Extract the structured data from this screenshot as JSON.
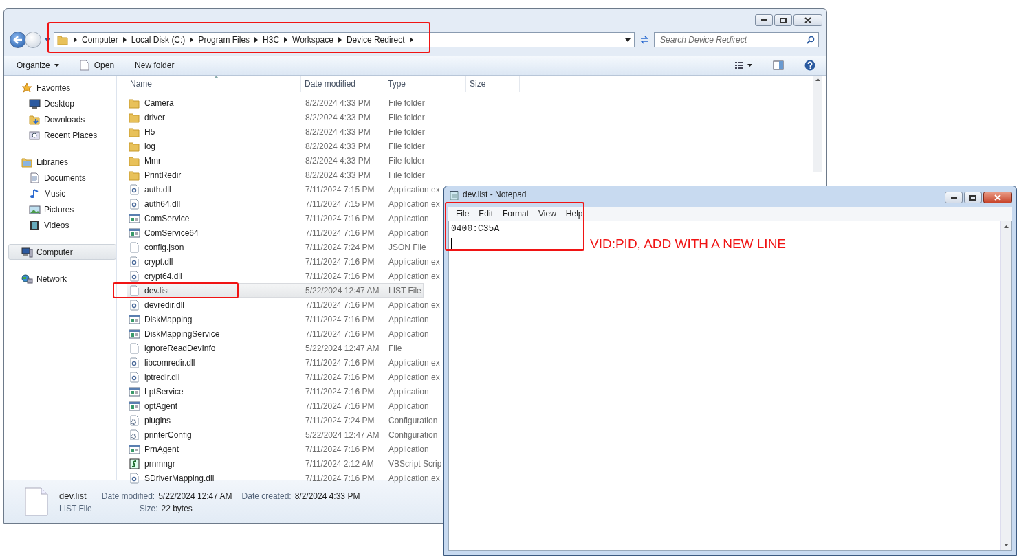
{
  "explorer": {
    "address": {
      "crumbs": [
        "Computer",
        "Local Disk (C:)",
        "Program Files",
        "H3C",
        "Workspace",
        "Device Redirect"
      ]
    },
    "search": {
      "placeholder": "Search Device Redirect"
    },
    "toolbar": {
      "organize": "Organize",
      "open": "Open",
      "new_folder": "New folder"
    },
    "sidebar": {
      "groups": [
        {
          "label": "Favorites",
          "selected": false,
          "children": [
            {
              "label": "Desktop",
              "selected": false
            },
            {
              "label": "Downloads",
              "selected": false
            },
            {
              "label": "Recent Places",
              "selected": false
            }
          ]
        },
        {
          "label": "Libraries",
          "selected": false,
          "children": [
            {
              "label": "Documents",
              "selected": false
            },
            {
              "label": "Music",
              "selected": false
            },
            {
              "label": "Pictures",
              "selected": false
            },
            {
              "label": "Videos",
              "selected": false
            }
          ]
        },
        {
          "label": "Computer",
          "selected": true
        },
        {
          "label": "Network",
          "selected": false
        }
      ]
    },
    "table": {
      "columns": [
        "Name",
        "Date modified",
        "Type",
        "Size"
      ],
      "rows": [
        {
          "kind": "folder",
          "name": "Camera",
          "date": "8/2/2024 4:33 PM",
          "type": "File folder",
          "selected": false
        },
        {
          "kind": "folder",
          "name": "driver",
          "date": "8/2/2024 4:33 PM",
          "type": "File folder",
          "selected": false
        },
        {
          "kind": "folder",
          "name": "H5",
          "date": "8/2/2024 4:33 PM",
          "type": "File folder",
          "selected": false
        },
        {
          "kind": "folder",
          "name": "log",
          "date": "8/2/2024 4:33 PM",
          "type": "File folder",
          "selected": false
        },
        {
          "kind": "folder",
          "name": "Mmr",
          "date": "8/2/2024 4:33 PM",
          "type": "File folder",
          "selected": false
        },
        {
          "kind": "folder",
          "name": "PrintRedir",
          "date": "8/2/2024 4:33 PM",
          "type": "File folder",
          "selected": false
        },
        {
          "kind": "dll",
          "name": "auth.dll",
          "date": "7/11/2024 7:15 PM",
          "type": "Application ex",
          "selected": false
        },
        {
          "kind": "dll",
          "name": "auth64.dll",
          "date": "7/11/2024 7:15 PM",
          "type": "Application ex",
          "selected": false
        },
        {
          "kind": "app",
          "name": "ComService",
          "date": "7/11/2024 7:16 PM",
          "type": "Application",
          "selected": false
        },
        {
          "kind": "app",
          "name": "ComService64",
          "date": "7/11/2024 7:16 PM",
          "type": "Application",
          "selected": false
        },
        {
          "kind": "file",
          "name": "config.json",
          "date": "7/11/2024 7:24 PM",
          "type": "JSON File",
          "selected": false
        },
        {
          "kind": "dll",
          "name": "crypt.dll",
          "date": "7/11/2024 7:16 PM",
          "type": "Application ex",
          "selected": false
        },
        {
          "kind": "dll",
          "name": "crypt64.dll",
          "date": "7/11/2024 7:16 PM",
          "type": "Application ex",
          "selected": false
        },
        {
          "kind": "file",
          "name": "dev.list",
          "date": "5/22/2024 12:47 AM",
          "type": "LIST File",
          "selected": true
        },
        {
          "kind": "dll",
          "name": "devredir.dll",
          "date": "7/11/2024 7:16 PM",
          "type": "Application ex",
          "selected": false
        },
        {
          "kind": "app",
          "name": "DiskMapping",
          "date": "7/11/2024 7:16 PM",
          "type": "Application",
          "selected": false
        },
        {
          "kind": "app",
          "name": "DiskMappingService",
          "date": "7/11/2024 7:16 PM",
          "type": "Application",
          "selected": false
        },
        {
          "kind": "file",
          "name": "ignoreReadDevInfo",
          "date": "5/22/2024 12:47 AM",
          "type": "File",
          "selected": false
        },
        {
          "kind": "dll",
          "name": "libcomredir.dll",
          "date": "7/11/2024 7:16 PM",
          "type": "Application ex",
          "selected": false
        },
        {
          "kind": "dll",
          "name": "lptredir.dll",
          "date": "7/11/2024 7:16 PM",
          "type": "Application ex",
          "selected": false
        },
        {
          "kind": "app",
          "name": "LptService",
          "date": "7/11/2024 7:16 PM",
          "type": "Application",
          "selected": false
        },
        {
          "kind": "app",
          "name": "optAgent",
          "date": "7/11/2024 7:16 PM",
          "type": "Application",
          "selected": false
        },
        {
          "kind": "config",
          "name": "plugins",
          "date": "7/11/2024 7:24 PM",
          "type": "Configuration",
          "selected": false
        },
        {
          "kind": "config",
          "name": "printerConfig",
          "date": "5/22/2024 12:47 AM",
          "type": "Configuration",
          "selected": false
        },
        {
          "kind": "app",
          "name": "PrnAgent",
          "date": "7/11/2024 7:16 PM",
          "type": "Application",
          "selected": false
        },
        {
          "kind": "script",
          "name": "prnmngr",
          "date": "7/11/2024 2:12 AM",
          "type": "VBScript Scrip",
          "selected": false
        },
        {
          "kind": "dll",
          "name": "SDriverMapping.dll",
          "date": "7/11/2024 7:16 PM",
          "type": "Application ex",
          "selected": false
        }
      ]
    },
    "details": {
      "name": "dev.list",
      "type": "LIST File",
      "fields": [
        {
          "label": "Date modified:",
          "value": "5/22/2024 12:47 AM"
        },
        {
          "label": "Size:",
          "value": "22 bytes"
        },
        {
          "label": "Date created:",
          "value": "8/2/2024 4:33 PM"
        }
      ]
    }
  },
  "notepad": {
    "title": "dev.list - Notepad",
    "menu": [
      "File",
      "Edit",
      "Format",
      "View",
      "Help"
    ],
    "lines": [
      "0400:C35A"
    ]
  },
  "annotation": {
    "text": "VID:PID, ADD WITH A NEW LINE"
  }
}
